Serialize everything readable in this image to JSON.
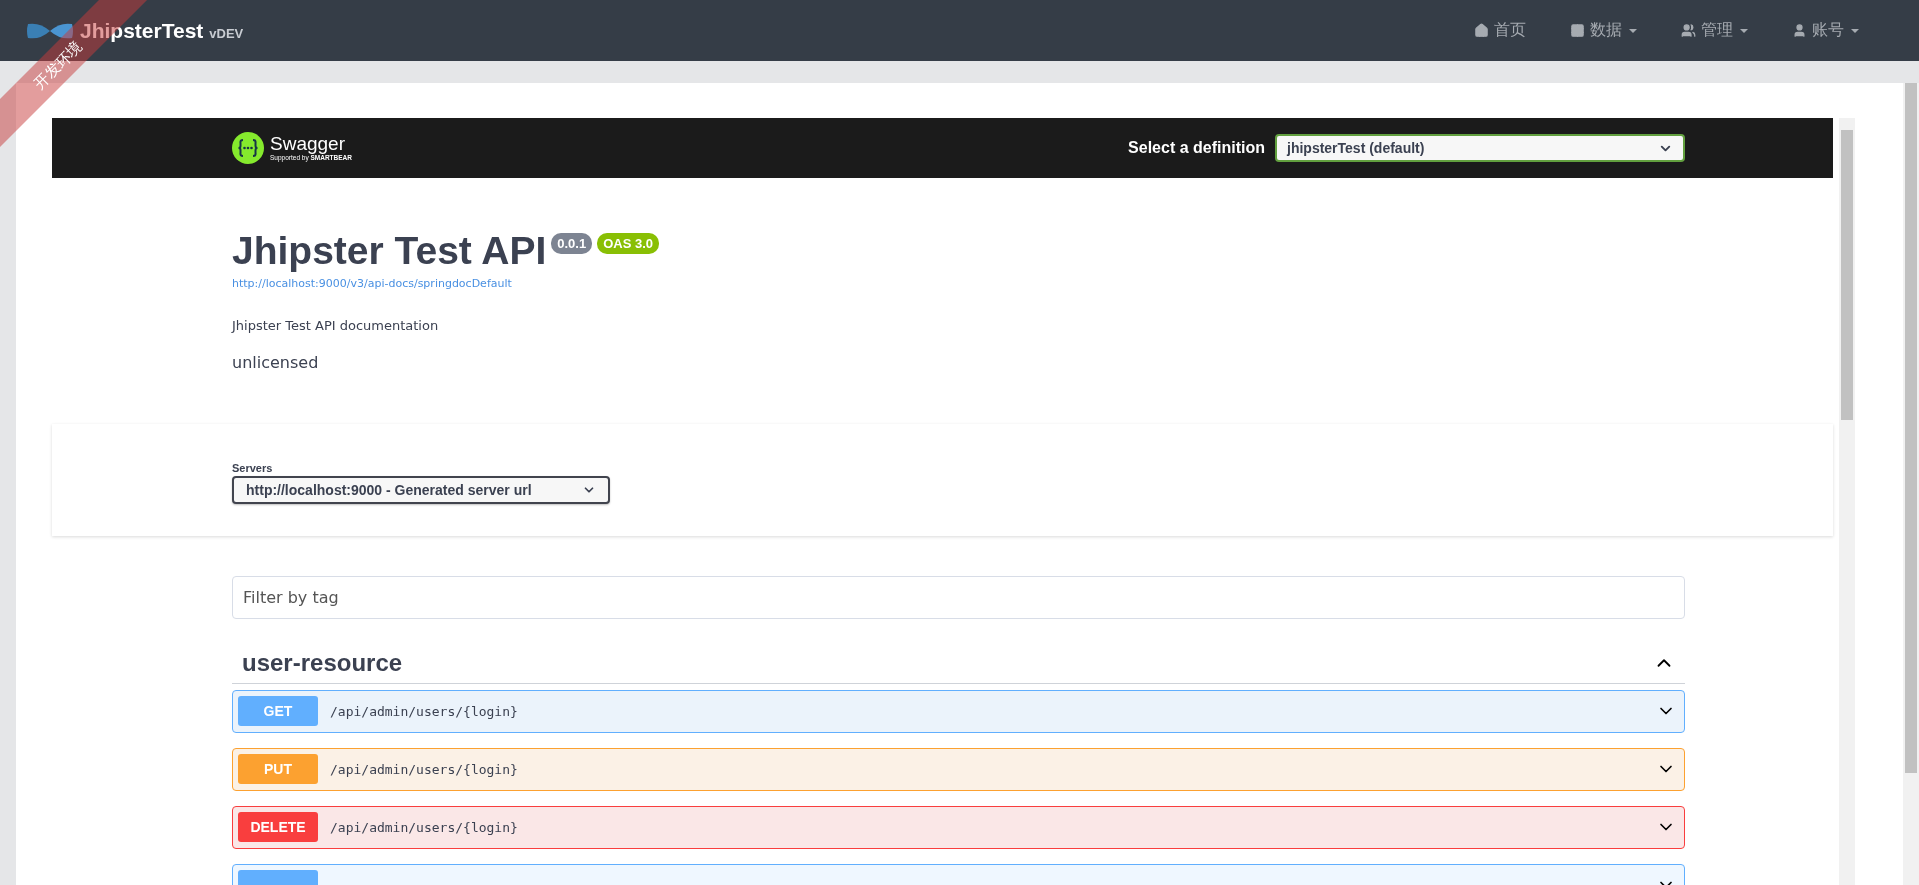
{
  "ribbon": {
    "text": "开发环境"
  },
  "navbar": {
    "brand": "JhipsterTest",
    "version": "vDEV",
    "items": [
      {
        "label": "首页",
        "dropdown": false
      },
      {
        "label": "数据",
        "dropdown": true
      },
      {
        "label": "管理",
        "dropdown": true
      },
      {
        "label": "账号",
        "dropdown": true
      }
    ]
  },
  "swagger": {
    "brand": "Swagger",
    "tagline": "Supported by **SMARTBEAR**",
    "definition_label": "Select a definition",
    "definition": "jhipsterTest (default)"
  },
  "info": {
    "title": "Jhipster Test API",
    "version": "0.0.1",
    "oas": "OAS 3.0",
    "url": "http://localhost:9000/v3/api-docs/springdocDefault",
    "description": "Jhipster Test API documentation",
    "license": "unlicensed"
  },
  "servers": {
    "label": "Servers",
    "selected": "http://localhost:9000 - Generated server url"
  },
  "filter": {
    "placeholder": "Filter by tag"
  },
  "tag": {
    "name": "user-resource",
    "expanded": true,
    "operations": [
      {
        "method": "GET",
        "path": "/api/admin/users/{login}"
      },
      {
        "method": "PUT",
        "path": "/api/admin/users/{login}"
      },
      {
        "method": "DELETE",
        "path": "/api/admin/users/{login}"
      },
      {
        "color": "#61affe"
      }
    ]
  }
}
